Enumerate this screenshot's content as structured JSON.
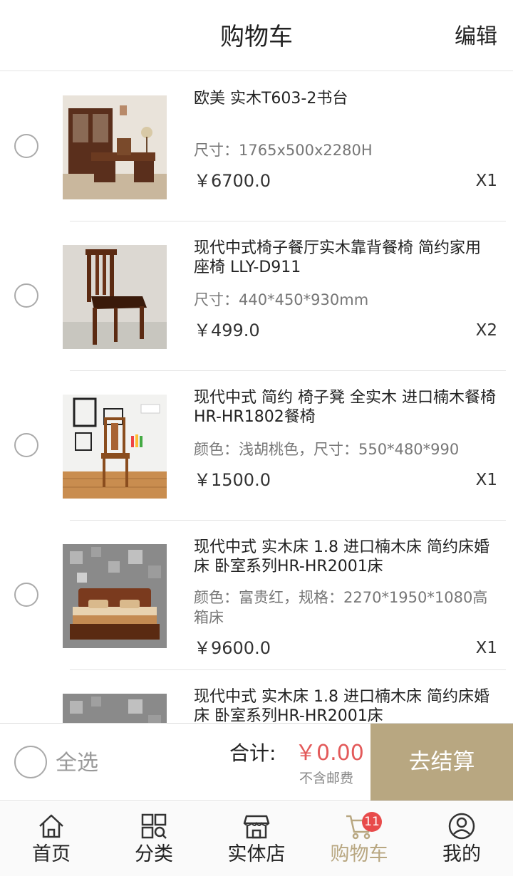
{
  "header": {
    "title": "购物车",
    "edit_label": "编辑"
  },
  "cart_items": [
    {
      "name": "欧美 实木T603-2书台",
      "spec": "尺寸：1765x500x2280H",
      "price": "￥6700.0",
      "qty": "X1",
      "image": "desk-photo"
    },
    {
      "name": "现代中式椅子餐厅实木靠背餐椅 简约家用座椅   LLY-D911",
      "spec": "尺寸：440*450*930mm",
      "price": "￥499.0",
      "qty": "X2",
      "image": "chair-photo"
    },
    {
      "name": "现代中式 简约 椅子凳 全实木 进口楠木餐椅    HR-HR1802餐椅",
      "spec": "颜色：浅胡桃色，尺寸：550*480*990",
      "price": "￥1500.0",
      "qty": "X1",
      "image": "dining-chair-photo"
    },
    {
      "name": "现代中式 实木床 1.8 进口楠木床 简约床婚床 卧室系列HR-HR2001床",
      "spec": "颜色：富贵红，规格：2270*1950*1080高箱床",
      "price": "￥9600.0",
      "qty": "X1",
      "image": "bed-photo"
    },
    {
      "name": "现代中式 实木床 1.8 进口楠木床 简约床婚床 卧室系列HR-HR2001床",
      "spec": "",
      "price": "",
      "qty": "",
      "image": "bed-photo"
    }
  ],
  "checkout": {
    "select_all_label": "全选",
    "total_label": "合计:",
    "total_value": "￥0.00",
    "shipping_note": "不含邮费",
    "pay_label": "去结算"
  },
  "tabbar": {
    "tabs": [
      {
        "label": "首页",
        "icon": "home-icon"
      },
      {
        "label": "分类",
        "icon": "category-icon"
      },
      {
        "label": "实体店",
        "icon": "store-icon"
      },
      {
        "label": "购物车",
        "icon": "cart-icon",
        "badge": "11",
        "active": true
      },
      {
        "label": "我的",
        "icon": "user-icon"
      }
    ]
  },
  "colors": {
    "accent": "#b8a781",
    "price_red": "#e35a5a",
    "badge": "#e84b4b"
  }
}
